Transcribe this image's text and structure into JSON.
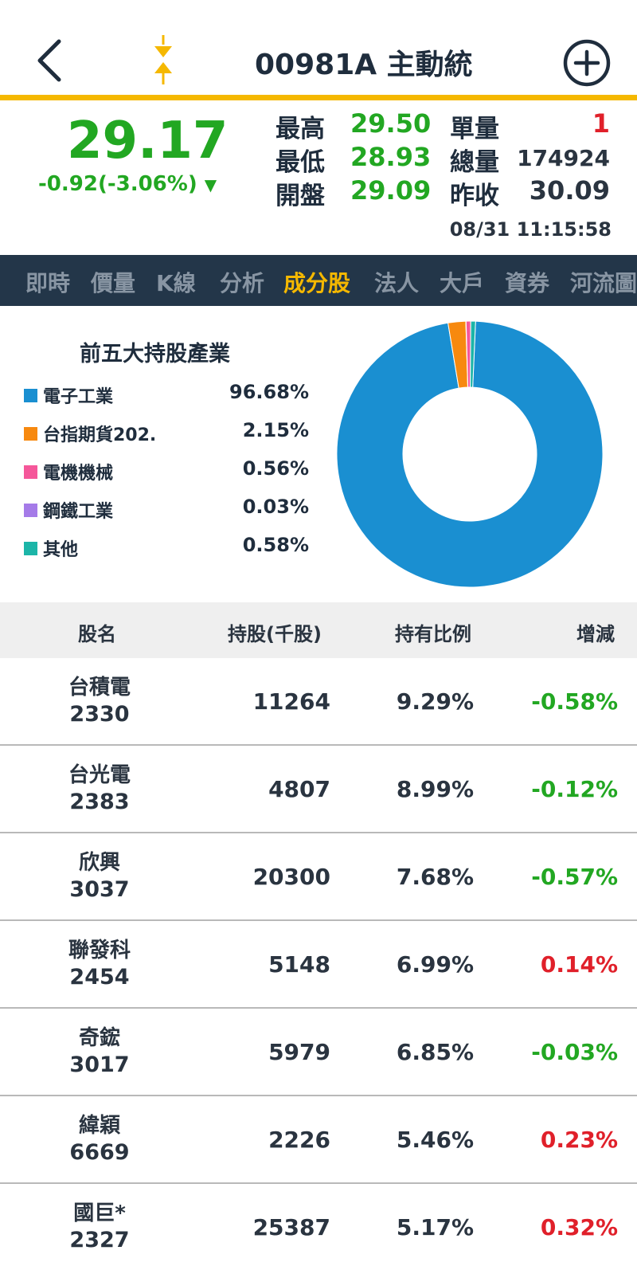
{
  "header": {
    "title": "00981A 主動統",
    "accent": "#f5b800"
  },
  "quote": {
    "price": "29.17",
    "change": "-0.92(-3.06%)",
    "change_arrow": "▼",
    "high_label": "最高",
    "high": "29.50",
    "low_label": "最低",
    "low": "28.93",
    "open_label": "開盤",
    "open": "29.09",
    "unit_vol_label": "單量",
    "unit_vol": "1",
    "total_vol_label": "總量",
    "total_vol": "174924",
    "prev_close_label": "昨收",
    "prev_close": "30.09",
    "timestamp": "08/31 11:15:58"
  },
  "tabs": [
    {
      "label": "即時"
    },
    {
      "label": "價量"
    },
    {
      "label": "K線"
    },
    {
      "label": "分析"
    },
    {
      "label": "成分股",
      "active": true
    },
    {
      "label": "法人"
    },
    {
      "label": "大戶"
    },
    {
      "label": "資券"
    },
    {
      "label": "河流圖"
    }
  ],
  "industry": {
    "title": "前五大持股產業",
    "chart_data": {
      "type": "pie",
      "categories": [
        "電子工業",
        "台指期貨202.",
        "電機機械",
        "鋼鐵工業",
        "其他"
      ],
      "values": [
        96.68,
        2.15,
        0.56,
        0.03,
        0.58
      ],
      "labels": [
        "96.68%",
        "2.15%",
        "0.56%",
        "0.03%",
        "0.58%"
      ],
      "colors": [
        "#1a8fd1",
        "#f7890f",
        "#f5579a",
        "#a57be8",
        "#1cb5a8"
      ]
    }
  },
  "table": {
    "headers": [
      "股名",
      "持股(千股)",
      "持有比例",
      "增減"
    ],
    "rows": [
      {
        "name": "台積電",
        "code": "2330",
        "shares": "11264",
        "ratio": "9.29%",
        "delta": "-0.58%",
        "dir": "neg"
      },
      {
        "name": "台光電",
        "code": "2383",
        "shares": "4807",
        "ratio": "8.99%",
        "delta": "-0.12%",
        "dir": "neg"
      },
      {
        "name": "欣興",
        "code": "3037",
        "shares": "20300",
        "ratio": "7.68%",
        "delta": "-0.57%",
        "dir": "neg"
      },
      {
        "name": "聯發科",
        "code": "2454",
        "shares": "5148",
        "ratio": "6.99%",
        "delta": "0.14%",
        "dir": "pos"
      },
      {
        "name": "奇鋐",
        "code": "3017",
        "shares": "5979",
        "ratio": "6.85%",
        "delta": "-0.03%",
        "dir": "neg"
      },
      {
        "name": "緯穎",
        "code": "6669",
        "shares": "2226",
        "ratio": "5.46%",
        "delta": "0.23%",
        "dir": "pos"
      },
      {
        "name": "國巨*",
        "code": "2327",
        "shares": "25387",
        "ratio": "5.17%",
        "delta": "0.32%",
        "dir": "pos"
      }
    ]
  }
}
